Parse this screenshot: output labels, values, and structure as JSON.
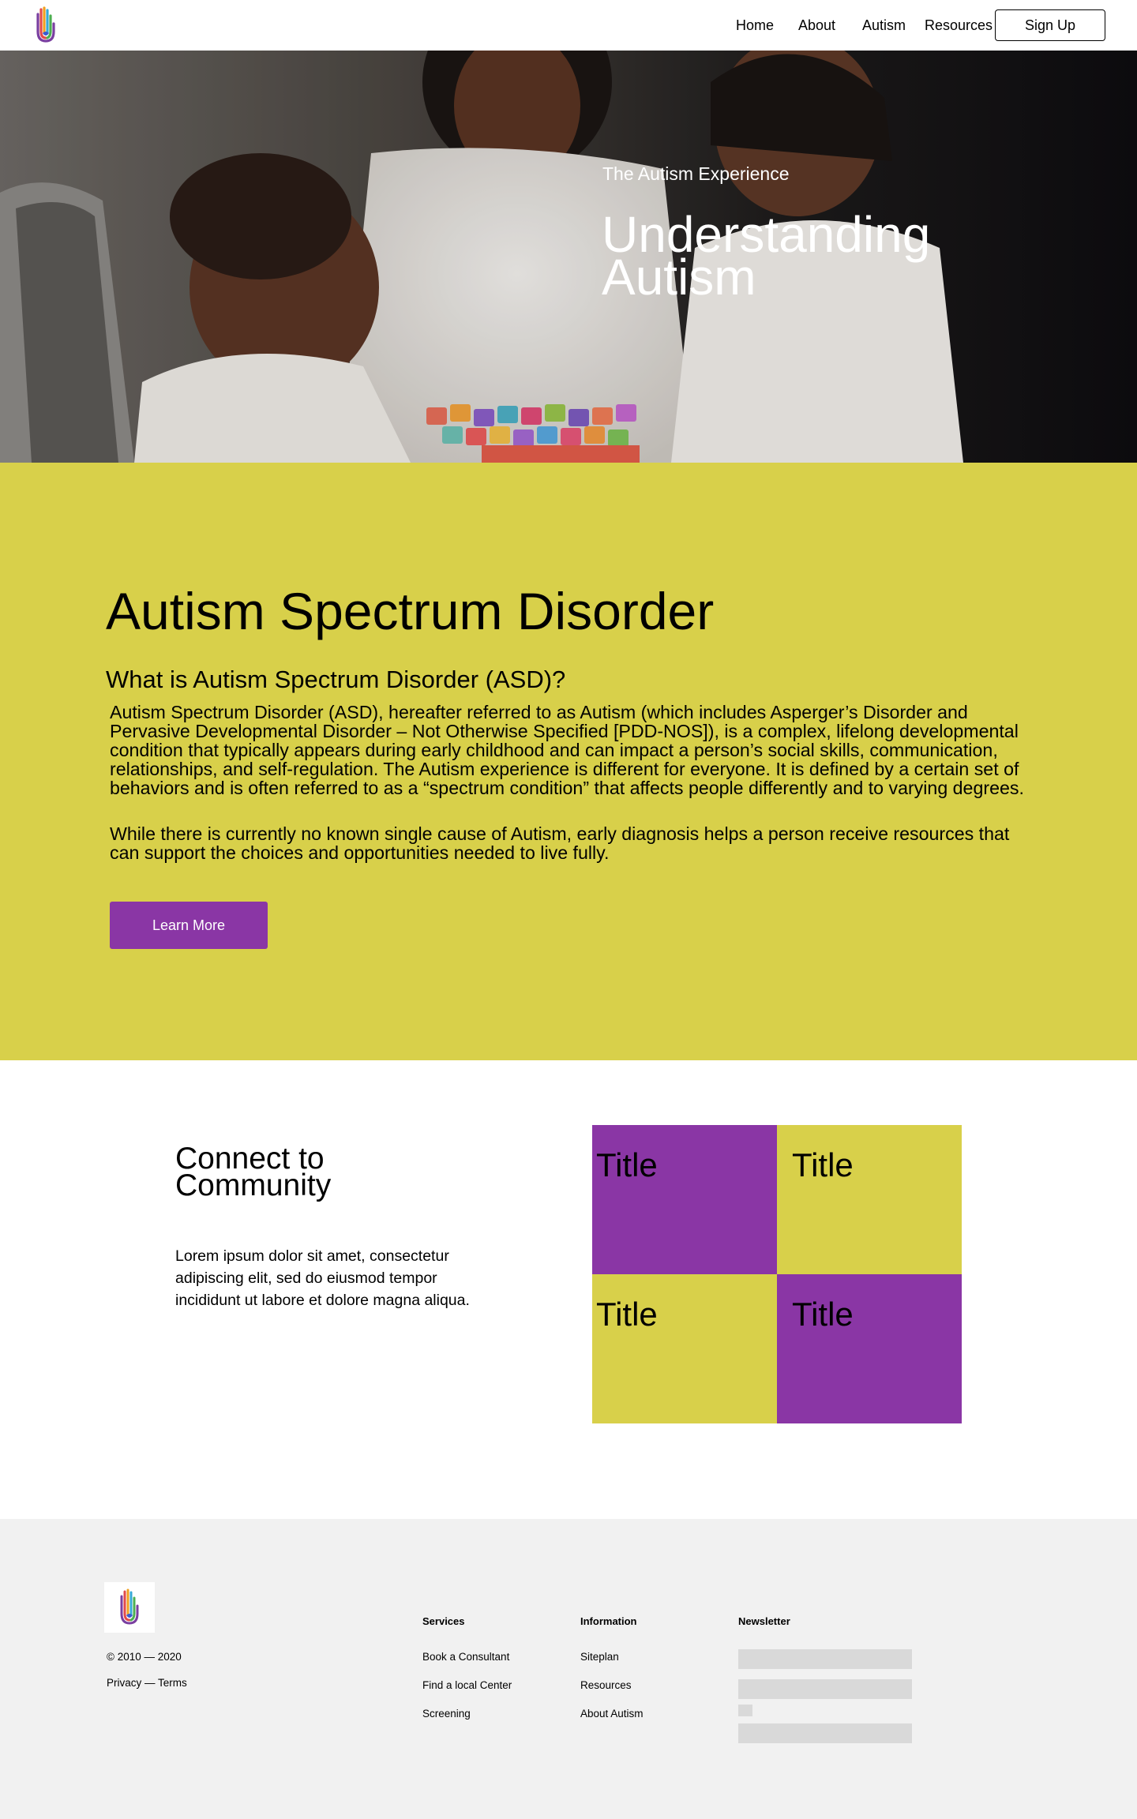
{
  "header": {
    "nav": [
      "Home",
      "About",
      "Autism",
      "Resources"
    ],
    "signup_label": "Sign Up",
    "logo_icon": "hand-logo-icon"
  },
  "hero": {
    "kicker": "The Autism Experience",
    "title": "Understanding Autism",
    "image": "photo-mother-with-two-children-playing-with-colorful-blocks"
  },
  "info": {
    "heading": "Autism Spectrum Disorder",
    "subheading": "What is Autism Spectrum Disorder (ASD)?",
    "paragraph1": "Autism Spectrum Disorder (ASD), hereafter referred to as Autism (which includes Asperger’s Disorder and Pervasive Developmental Disorder – Not Otherwise Specified [PDD-NOS]), is a complex, lifelong developmental condition that typically appears during early childhood and can impact a person’s social skills, communication, relationships, and self-regulation. The Autism experience is different for everyone. It is defined by a certain set of behaviors and is often referred to as a “spectrum condition” that affects people differently and to varying degrees.",
    "paragraph2": "While there is currently no known single cause of Autism, early diagnosis helps a person receive resources that can support the choices and opportunities needed to live fully.",
    "button_label": "Learn More"
  },
  "community": {
    "title": "Connect to Community",
    "text": "Lorem ipsum dolor sit amet, consectetur adipiscing elit, sed do eiusmod tempor incididunt ut labore et dolore magna aliqua.",
    "tiles": [
      {
        "label": "Title",
        "color": "#8a36a5"
      },
      {
        "label": "Title",
        "color": "#d8d04a"
      },
      {
        "label": "Title",
        "color": "#d8d04a"
      },
      {
        "label": "Title",
        "color": "#8a36a5"
      }
    ]
  },
  "footer": {
    "copyright": "© 2010 — 2020",
    "legal": "Privacy — Terms",
    "services": {
      "heading": "Services",
      "links": [
        "Book a Consultant",
        "Find a local Center",
        "Screening"
      ]
    },
    "information": {
      "heading": "Information",
      "links": [
        "Siteplan",
        "Resources",
        "About Autism"
      ]
    },
    "newsletter": {
      "heading": "Newsletter"
    }
  },
  "colors": {
    "accent_yellow": "#d8d04a",
    "accent_purple": "#8a36a5",
    "footer_bg": "#f1f1f1",
    "field_gray": "#d9d9d9"
  }
}
